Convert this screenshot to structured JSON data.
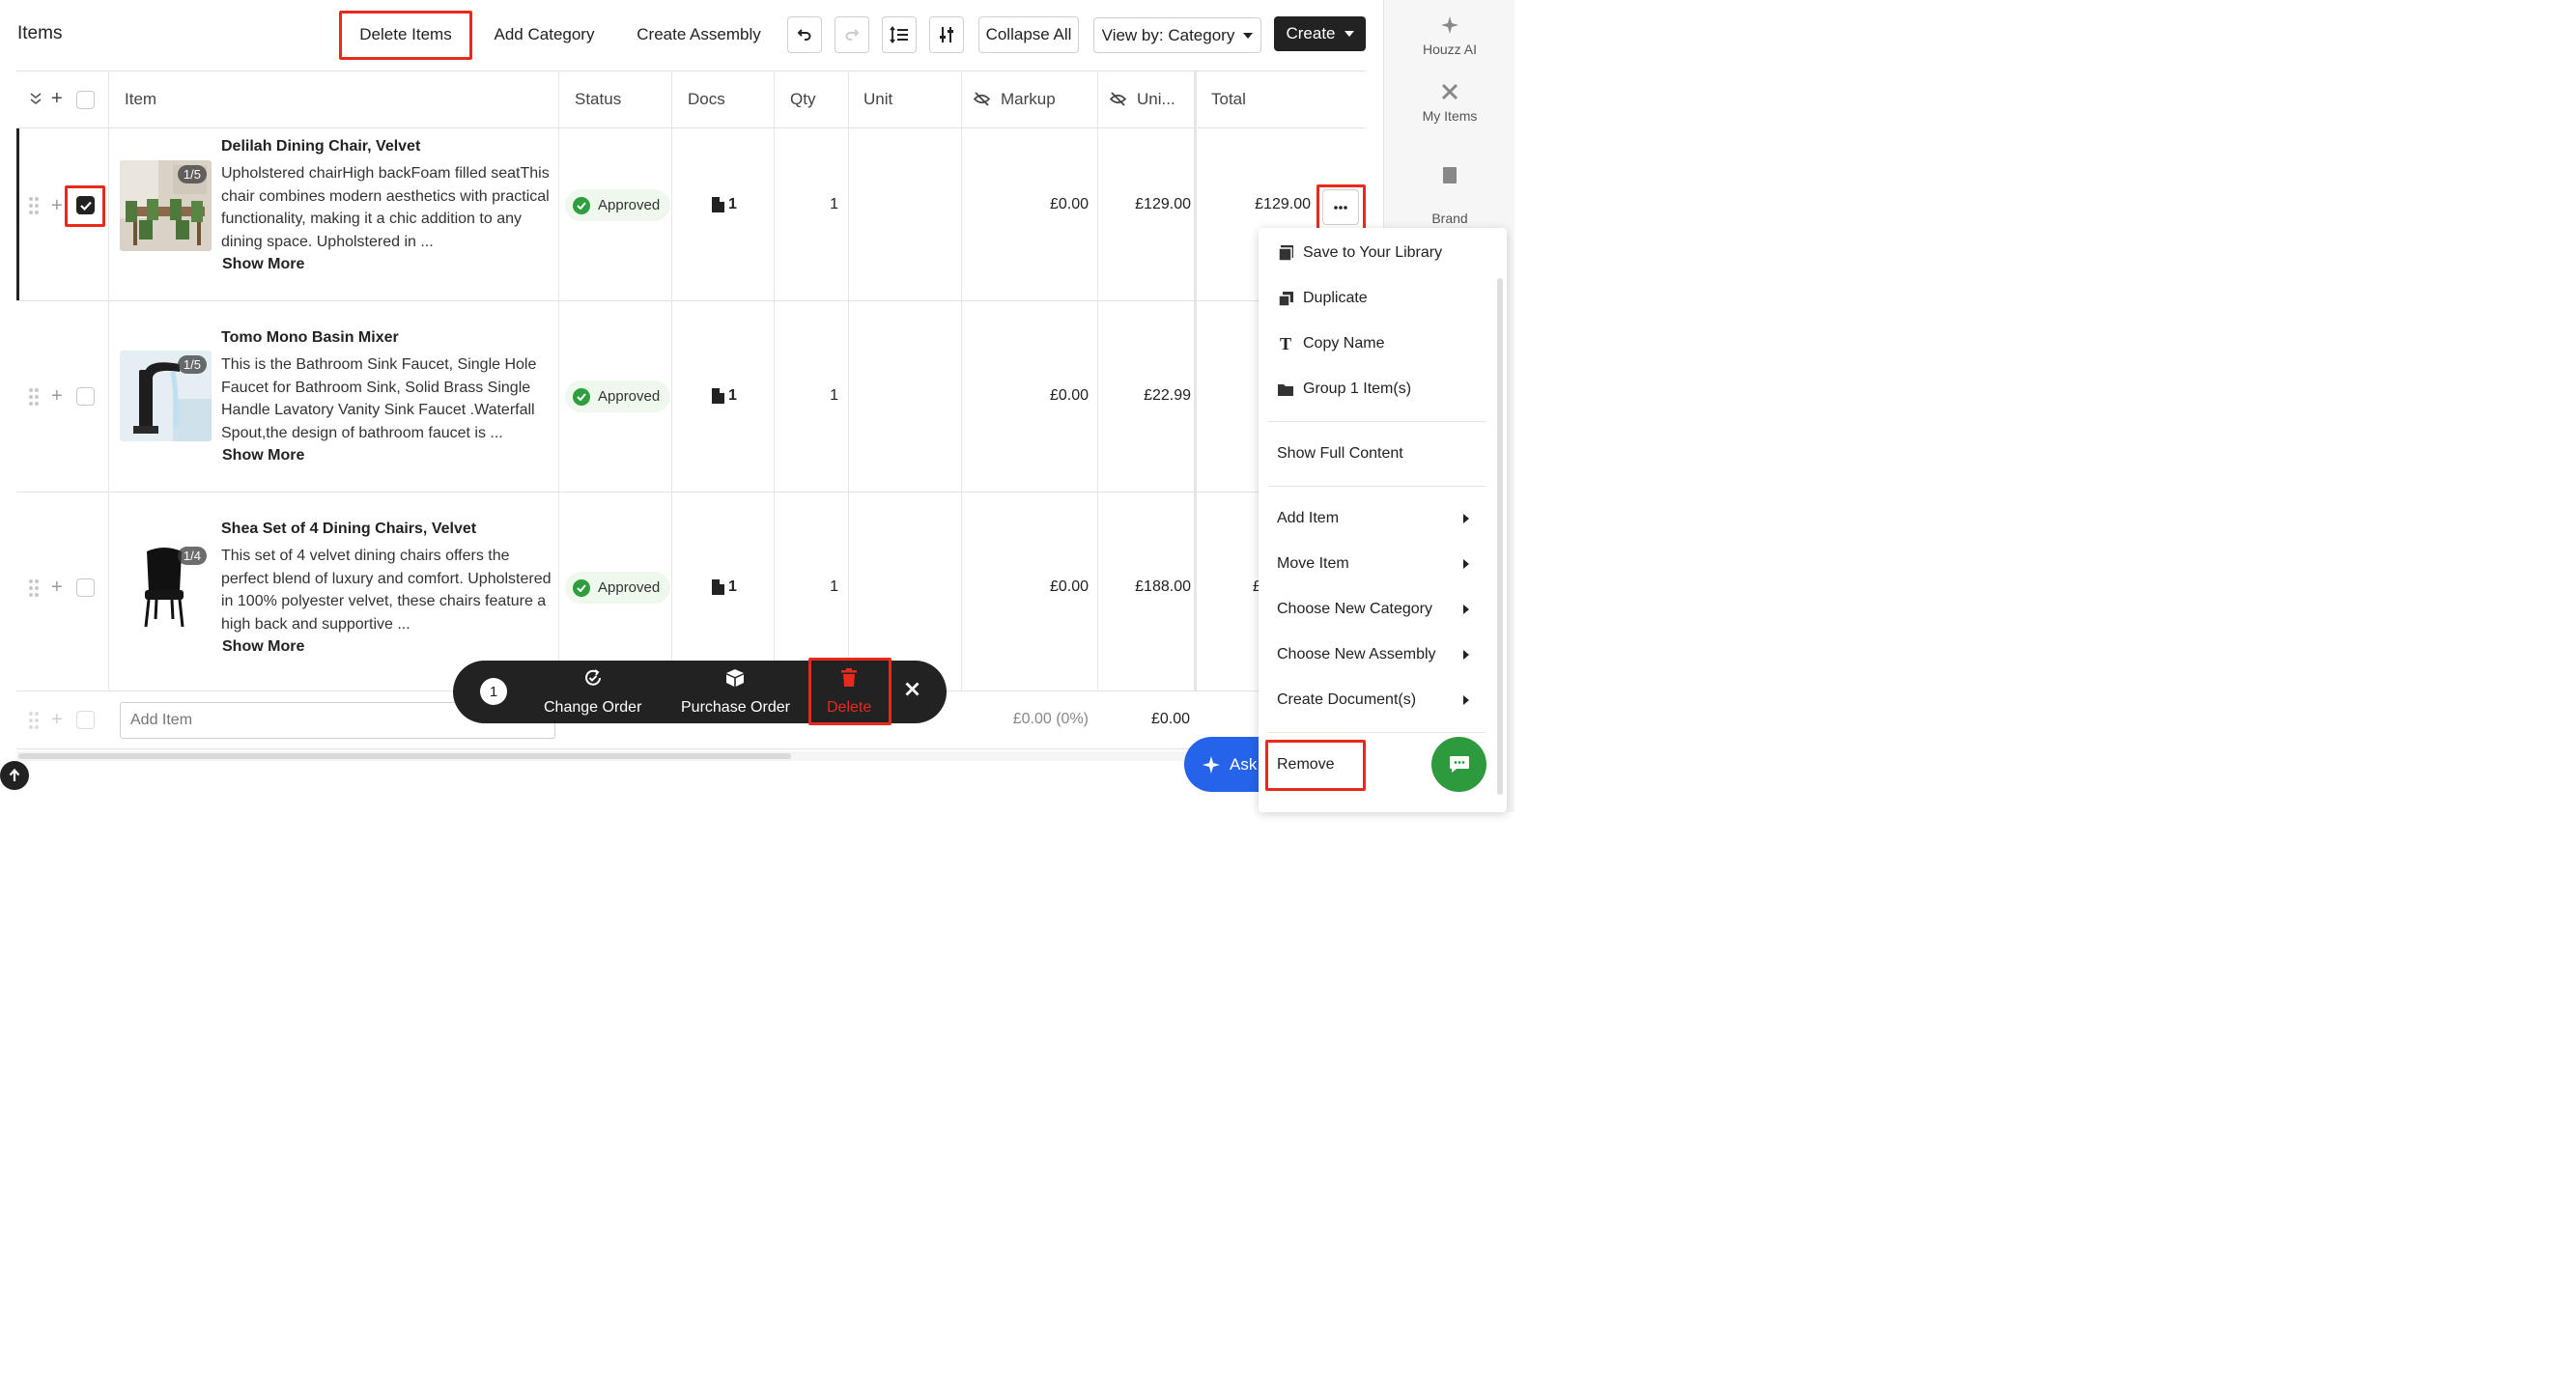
{
  "page": {
    "title": "Items"
  },
  "toolbar": {
    "delete_items": "Delete Items",
    "add_category": "Add Category",
    "create_assembly": "Create Assembly",
    "collapse_all": "Collapse All",
    "view_by": "View by: Category",
    "create": "Create"
  },
  "rail": {
    "items": [
      {
        "label": "Houzz AI",
        "icon": "sparkle-icon"
      },
      {
        "label": "My Items",
        "icon": "tools-icon"
      },
      {
        "label": "Brand\nLibraries",
        "icon": "book-icon"
      }
    ]
  },
  "table": {
    "columns": {
      "item": "Item",
      "status": "Status",
      "docs": "Docs",
      "qty": "Qty",
      "unit": "Unit",
      "markup": "Markup",
      "unit_price": "Uni...",
      "total": "Total"
    },
    "rows": [
      {
        "badge": "1/5",
        "name": "Delilah Dining Chair, Velvet",
        "desc": "Upholstered chairHigh backFoam filled seatThis chair combines modern aesthetics with practical functionality, making it a chic addition to any dining space. Upholstered in ...",
        "show_more": "Show More",
        "status": "Approved",
        "docs": "1",
        "qty": "1",
        "unit": "",
        "markup": "£0.00",
        "unit_price": "£129.00",
        "total": "£129.00",
        "checked": true
      },
      {
        "badge": "1/5",
        "name": "Tomo Mono Basin Mixer",
        "desc": "This is the Bathroom Sink Faucet, Single Hole Faucet for Bathroom Sink, Solid Brass Single Handle Lavatory Vanity Sink Faucet .Waterfall Spout,the design of bathroom faucet is ...",
        "show_more": "Show More",
        "status": "Approved",
        "docs": "1",
        "qty": "1",
        "unit": "",
        "markup": "£0.00",
        "unit_price": "£22.99",
        "total": "",
        "checked": false
      },
      {
        "badge": "1/4",
        "name": "Shea Set of 4 Dining Chairs, Velvet",
        "desc": "This set of 4 velvet dining chairs offers the perfect blend of luxury and comfort. Upholstered in 100% polyester velvet, these chairs feature a high back and supportive ...",
        "show_more": "Show More",
        "status": "Approved",
        "docs": "1",
        "qty": "1",
        "unit": "",
        "markup": "£0.00",
        "unit_price": "£188.00",
        "total": "£",
        "checked": false
      }
    ],
    "footer": {
      "add_item_placeholder": "Add Item",
      "markup_total": "£0.00 (0%)",
      "unit_total": "£0.00"
    }
  },
  "menu": {
    "items": [
      "Save to Your Library",
      "Duplicate",
      "Copy Name",
      "Group 1 Item(s)",
      "Show Full Content",
      "Add Item",
      "Move Item",
      "Choose New Category",
      "Choose New Assembly",
      "Create Document(s)",
      "Remove"
    ]
  },
  "action_bar": {
    "count": "1",
    "change_order": "Change Order",
    "purchase_order": "Purchase Order",
    "delete": "Delete"
  },
  "ask": {
    "label": "Ask"
  },
  "colors": {
    "accent": "#e8291c",
    "approved": "#2e9e3e",
    "dark": "#222222",
    "chat": "#2d9a3e",
    "ask": "#2563eb"
  }
}
